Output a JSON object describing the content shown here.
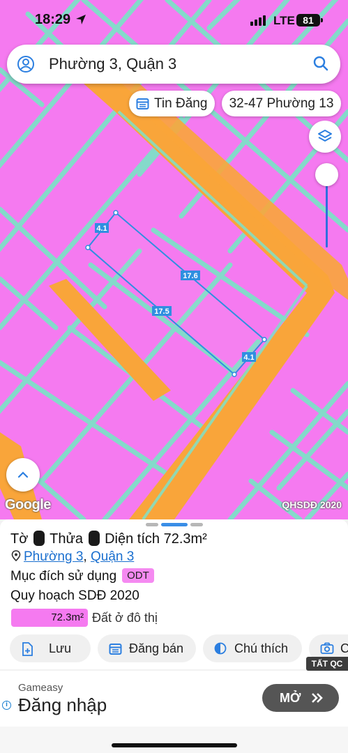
{
  "status_bar": {
    "time": "18:29",
    "network": "LTE",
    "battery": "81"
  },
  "search": {
    "text": "Phường 3, Quận 3"
  },
  "chips": {
    "listing": "Tin Đăng",
    "ward": "32-47 Phường 13"
  },
  "map": {
    "edge_labels": [
      "4.1",
      "17.6",
      "17.5",
      "4.1"
    ],
    "google_label": "Google",
    "layer_label": "QHSDĐ 2020"
  },
  "parcel": {
    "title_prefix": "Tờ",
    "title_mid": "Thửa",
    "title_suffix": "Diện tích 72.3m²",
    "ward_link": "Phường 3",
    "district_link": "Quận 3",
    "purpose_label": "Mục đích sử dụng",
    "purpose_code": "ODT",
    "plan_label": "Quy hoạch SDĐ 2020",
    "legend_area": "72.3m²",
    "legend_text": "Đất ở đô thị"
  },
  "actions": [
    {
      "label": "Lưu"
    },
    {
      "label": "Đăng bán"
    },
    {
      "label": "Chú thích"
    },
    {
      "label": "C"
    }
  ],
  "ad": {
    "badge": "TẤT QC",
    "brand": "Gameasy",
    "headline": "Đăng nhập",
    "cta": "MỞ"
  },
  "colors": {
    "land_residential": "#f57af0",
    "road": "#f9a53a",
    "border": "#7fe0c8",
    "parcel_outline": "#2f8fe0",
    "link": "#1a6fcf"
  }
}
